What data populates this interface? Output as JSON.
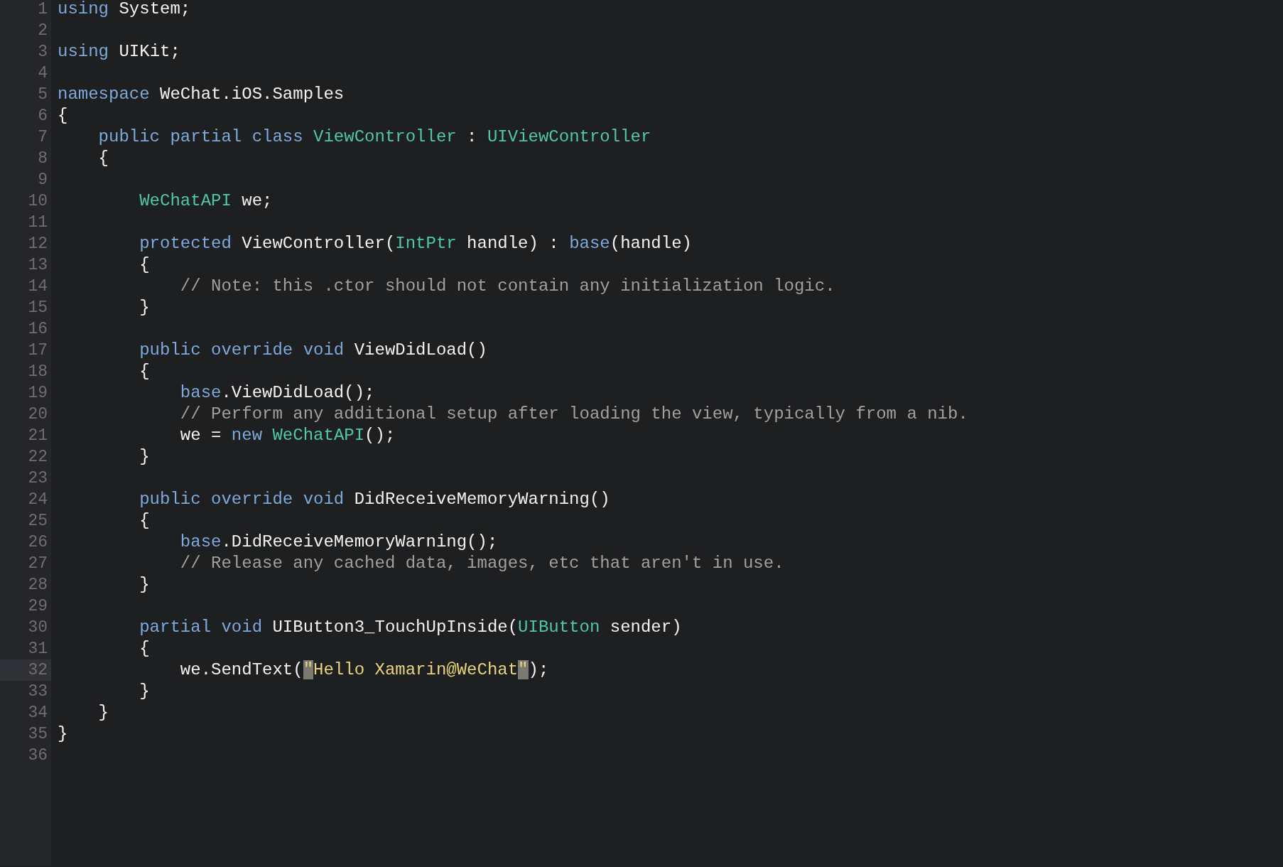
{
  "editor": {
    "lines": [
      {
        "number": "1",
        "current": false,
        "tokens": [
          {
            "text": "using",
            "kind": "keyword"
          },
          {
            "text": " System;",
            "kind": "plain"
          }
        ]
      },
      {
        "number": "2",
        "current": false
      },
      {
        "number": "3",
        "current": false,
        "tokens": [
          {
            "text": "using",
            "kind": "keyword"
          },
          {
            "text": " UIKit;",
            "kind": "plain"
          }
        ]
      },
      {
        "number": "4",
        "current": false
      },
      {
        "number": "5",
        "current": false,
        "tokens": [
          {
            "text": "namespace",
            "kind": "keyword"
          },
          {
            "text": " WeChat.iOS.Samples",
            "kind": "plain"
          }
        ]
      },
      {
        "number": "6",
        "current": false,
        "tokens": [
          {
            "text": "{",
            "kind": "plain"
          }
        ]
      },
      {
        "number": "7",
        "current": false,
        "tokens": [
          {
            "text": "    public partial class",
            "kind": "keyword"
          },
          {
            "text": " ViewController",
            "kind": "type"
          },
          {
            "text": " : ",
            "kind": "plain"
          },
          {
            "text": "UIViewController",
            "kind": "type"
          }
        ]
      },
      {
        "number": "8",
        "current": false,
        "tokens": [
          {
            "text": "    {",
            "kind": "plain"
          }
        ]
      },
      {
        "number": "9",
        "current": false
      },
      {
        "number": "10",
        "current": false,
        "tokens": [
          {
            "text": "        WeChatAPI",
            "kind": "type"
          },
          {
            "text": " we;",
            "kind": "plain"
          }
        ]
      },
      {
        "number": "11",
        "current": false
      },
      {
        "number": "12",
        "current": false,
        "tokens": [
          {
            "text": "        protected",
            "kind": "keyword"
          },
          {
            "text": " ViewController(",
            "kind": "plain"
          },
          {
            "text": "IntPtr",
            "kind": "type"
          },
          {
            "text": " handle) : ",
            "kind": "plain"
          },
          {
            "text": "base",
            "kind": "keyword"
          },
          {
            "text": "(handle)",
            "kind": "plain"
          }
        ]
      },
      {
        "number": "13",
        "current": false,
        "tokens": [
          {
            "text": "        {",
            "kind": "plain"
          }
        ]
      },
      {
        "number": "14",
        "current": false,
        "tokens": [
          {
            "text": "            // Note: this .ctor should not contain any initialization logic.",
            "kind": "comment"
          }
        ]
      },
      {
        "number": "15",
        "current": false,
        "tokens": [
          {
            "text": "        }",
            "kind": "plain"
          }
        ]
      },
      {
        "number": "16",
        "current": false
      },
      {
        "number": "17",
        "current": false,
        "tokens": [
          {
            "text": "        public override void",
            "kind": "keyword"
          },
          {
            "text": " ViewDidLoad()",
            "kind": "plain"
          }
        ]
      },
      {
        "number": "18",
        "current": false,
        "tokens": [
          {
            "text": "        {",
            "kind": "plain"
          }
        ]
      },
      {
        "number": "19",
        "current": false,
        "tokens": [
          {
            "text": "            base",
            "kind": "keyword"
          },
          {
            "text": ".ViewDidLoad();",
            "kind": "plain"
          }
        ]
      },
      {
        "number": "20",
        "current": false,
        "tokens": [
          {
            "text": "            // Perform any additional setup after loading the view, typically from a nib.",
            "kind": "comment"
          }
        ]
      },
      {
        "number": "21",
        "current": false,
        "tokens": [
          {
            "text": "            we = ",
            "kind": "plain"
          },
          {
            "text": "new",
            "kind": "keyword"
          },
          {
            "text": " WeChatAPI",
            "kind": "type"
          },
          {
            "text": "();",
            "kind": "plain"
          }
        ]
      },
      {
        "number": "22",
        "current": false,
        "tokens": [
          {
            "text": "        }",
            "kind": "plain"
          }
        ]
      },
      {
        "number": "23",
        "current": false
      },
      {
        "number": "24",
        "current": false,
        "tokens": [
          {
            "text": "        public override void",
            "kind": "keyword"
          },
          {
            "text": " DidReceiveMemoryWarning()",
            "kind": "plain"
          }
        ]
      },
      {
        "number": "25",
        "current": false,
        "tokens": [
          {
            "text": "        {",
            "kind": "plain"
          }
        ]
      },
      {
        "number": "26",
        "current": false,
        "tokens": [
          {
            "text": "            base",
            "kind": "keyword"
          },
          {
            "text": ".DidReceiveMemoryWarning();",
            "kind": "plain"
          }
        ]
      },
      {
        "number": "27",
        "current": false,
        "tokens": [
          {
            "text": "            // Release any cached data, images, etc that aren't in use.",
            "kind": "comment"
          }
        ]
      },
      {
        "number": "28",
        "current": false,
        "tokens": [
          {
            "text": "        }",
            "kind": "plain"
          }
        ]
      },
      {
        "number": "29",
        "current": false
      },
      {
        "number": "30",
        "current": false,
        "tokens": [
          {
            "text": "        partial void",
            "kind": "keyword"
          },
          {
            "text": " UIButton3_TouchUpInside(",
            "kind": "plain"
          },
          {
            "text": "UIButton",
            "kind": "type"
          },
          {
            "text": " sender)",
            "kind": "plain"
          }
        ]
      },
      {
        "number": "31",
        "current": false,
        "tokens": [
          {
            "text": "        {",
            "kind": "plain"
          }
        ]
      },
      {
        "number": "32",
        "current": true,
        "tokens": [
          {
            "text": "            we.SendText(",
            "kind": "plain"
          },
          {
            "text": "\"",
            "kind": "string",
            "matched": true
          },
          {
            "text": "Hello Xamarin@WeChat",
            "kind": "string"
          },
          {
            "text": "\"",
            "kind": "string",
            "matched": true
          },
          {
            "text": ");",
            "kind": "plain"
          }
        ]
      },
      {
        "number": "33",
        "current": false,
        "tokens": [
          {
            "text": "        }",
            "kind": "plain"
          }
        ]
      },
      {
        "number": "34",
        "current": false,
        "tokens": [
          {
            "text": "    }",
            "kind": "plain"
          }
        ]
      },
      {
        "number": "35",
        "current": false,
        "tokens": [
          {
            "text": "}",
            "kind": "plain"
          }
        ]
      },
      {
        "number": "36",
        "current": false
      }
    ]
  }
}
